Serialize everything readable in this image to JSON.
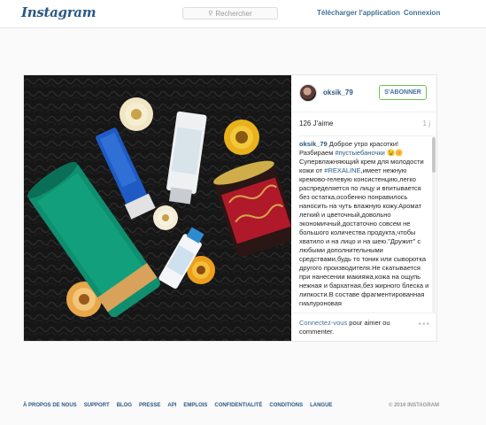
{
  "header": {
    "logo_text": "Instagram",
    "search_placeholder": "Rechercher",
    "download_label": "Télécharger l'application",
    "login_label": "Connexion"
  },
  "post": {
    "username": "oksik_79",
    "follow_label": "S'ABONNER",
    "likes": "126 J'aime",
    "time": "1 j",
    "caption_user": "oksik_79",
    "caption_lines": [
      "Доброе утро красотки!Разбираем",
      "#пустыебаночки",
      "😉🌼Супервлажняющий крем для молодости кожи от",
      "#REXALINE",
      ",имеет нежную кремово-гелевую консистенцию,легко распределяется по лицу и впитывается без остатка,особенно понравилось наносить на чуть влажную кожу.Аромат легкий и цветочный,довольно экономичный,достаточно совсем не большого количества продукта,чтобы хватило и на лицо и на шею.\"Дружит\" с любыми дополнительными средствами,будь то тоник или сыворотка другого производителя.Не скатывается при нанесении макияжа,кожа на ощупь нежная и бархатная,без жирного блеска и липкости.В составе фрагментированная гиалуроновая"
    ],
    "comment_link": "Connectez-vous",
    "comment_rest": " pour aimer ou commenter.",
    "more_dots": "•••"
  },
  "footer": {
    "links": [
      "À PROPOS DE NOUS",
      "SUPPORT",
      "BLOG",
      "PRESSE",
      "API",
      "EMPLOIS",
      "CONFIDENTIALITÉ",
      "CONDITIONS",
      "LANGUE"
    ],
    "copyright": "© 2016 INSTAGRAM"
  },
  "colors": {
    "link_blue": "#3f729b",
    "username_blue": "#2a5885",
    "follow_border": "#70c050"
  }
}
